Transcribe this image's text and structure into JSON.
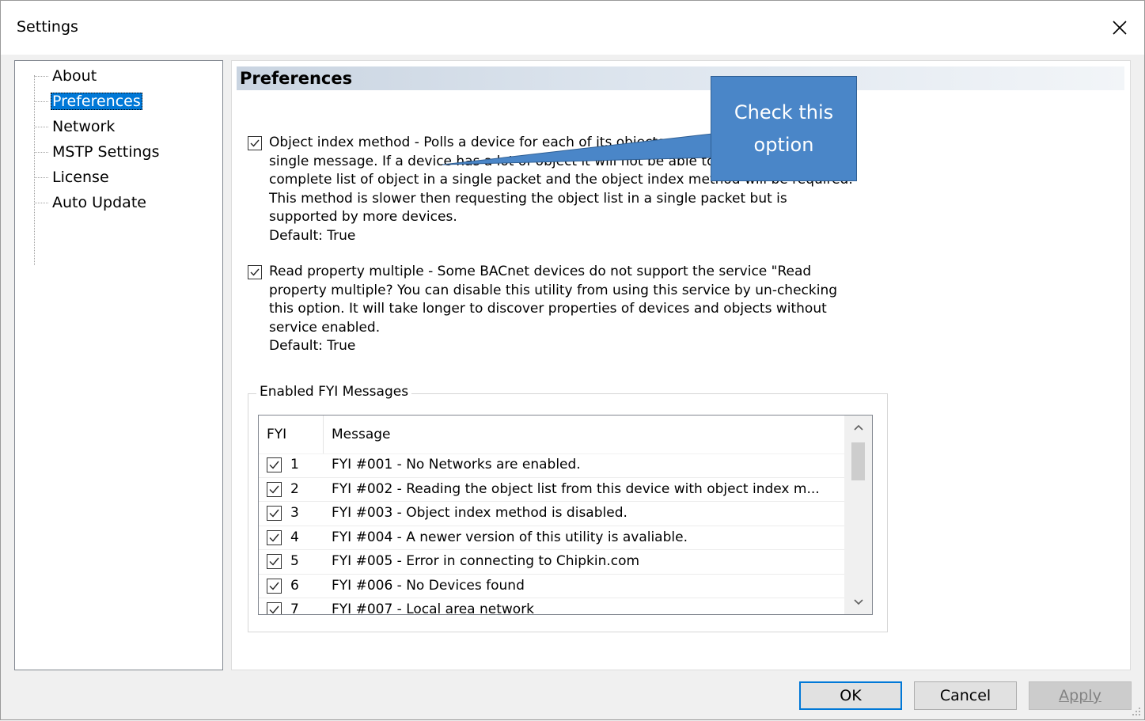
{
  "window": {
    "title": "Settings"
  },
  "tree": {
    "items": [
      {
        "label": "About",
        "selected": false
      },
      {
        "label": "Preferences",
        "selected": true
      },
      {
        "label": "Network",
        "selected": false
      },
      {
        "label": "MSTP Settings",
        "selected": false
      },
      {
        "label": "License",
        "selected": false
      },
      {
        "label": "Auto Update",
        "selected": false
      }
    ]
  },
  "preferences": {
    "title": "Preferences",
    "option1": {
      "checked": true,
      "lines": [
        "Object index method - Polls a device for each of its objects one at a time in a",
        "single message. If a device has a lot of object it will not be able to send the",
        "complete list of object in a single packet and the object index method will be required.",
        "This method is  slower then requesting the object list in a single packet but is",
        "supported by more devices.",
        "Default: True"
      ]
    },
    "option2": {
      "checked": true,
      "lines": [
        "Read property multiple - Some BACnet devices do not support the service \"Read",
        "property multiple? You can disable this utility from using this service by un-checking",
        "this option. It will take longer to discover properties of devices and objects without",
        "service enabled.",
        "Default: True"
      ]
    },
    "fyi_group": {
      "legend": "Enabled FYI Messages",
      "columns": {
        "fyi": "FYI",
        "message": "Message"
      },
      "rows": [
        {
          "checked": true,
          "num": "1",
          "message": "FYI #001 - No Networks are enabled."
        },
        {
          "checked": true,
          "num": "2",
          "message": "FYI #002 - Reading the object list from this device with object index m..."
        },
        {
          "checked": true,
          "num": "3",
          "message": "FYI #003 - Object index method is disabled."
        },
        {
          "checked": true,
          "num": "4",
          "message": "FYI #004 - A newer version of this utility is avaliable."
        },
        {
          "checked": true,
          "num": "5",
          "message": "FYI #005 - Error in connecting to Chipkin.com"
        },
        {
          "checked": true,
          "num": "6",
          "message": "FYI #006 - No Devices found"
        },
        {
          "checked": true,
          "num": "7",
          "message": "FYI #007 - Local area network"
        }
      ]
    }
  },
  "callout": {
    "line1": "Check this",
    "line2": "option"
  },
  "buttons": {
    "ok": "OK",
    "cancel": "Cancel",
    "apply": "Apply"
  }
}
